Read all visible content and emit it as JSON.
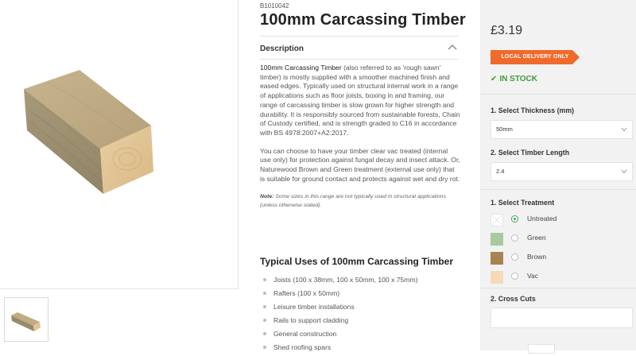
{
  "product": {
    "sku": "B1010042",
    "title": "100mm Carcassing Timber",
    "image_alt": "timber-plank-image"
  },
  "description": {
    "header": "Description",
    "para1_strong": "100mm Carcassing Timber",
    "para1_rest": " (also referred to as 'rough sawn' timber) is mostly supplied with a smoother machined finish and eased edges. Typically used on structural internal work in a range of applications such as floor joists, boxing in and framing, our range of carcassing timber is slow grown for higher strength and durability. It is responsibly sourced from sustainable forests, Chain of Custody certified, and is strength graded to C16 in accordance with BS 4978:2007+A2:2017.",
    "para2": "You can choose to have your timber clear vac treated (internal use only) for protection against fungal decay and insect attack. Or, Naturewood Brown and Green treatment (external use only) that is suitable for ground contact and protects against wet and dry rot.",
    "note_label": "Note:",
    "note_text": " Some sizes in this range are not typically used in structural applications (unless otherwise stated)."
  },
  "uses": {
    "title": "Typical Uses of 100mm Carcassing Timber",
    "items": [
      "Joists (100 x 38mm, 100 x 50mm, 100 x 75mm)",
      "Rafters (100 x 50mm)",
      "Leisure timber installations",
      "Rails to support cladding",
      "General construction",
      "Shed roofing spars"
    ]
  },
  "purchase": {
    "price": "£3.19",
    "delivery_badge": "LOCAL DELIVERY ONLY",
    "stock": "IN STOCK",
    "thickness_label": "1. Select Thickness (mm)",
    "thickness_value": "50mm",
    "length_label": "2. Select Timber Length",
    "length_value": "2.4",
    "treatment_label": "1. Select Treatment",
    "treatments": [
      {
        "label": "Untreated",
        "selected": true,
        "color": "#ffffff"
      },
      {
        "label": "Green",
        "selected": false,
        "color": "#a9c9a0"
      },
      {
        "label": "Brown",
        "selected": false,
        "color": "#a88353"
      },
      {
        "label": "Vac",
        "selected": false,
        "color": "#f6d9b6"
      }
    ],
    "crosscuts_label": "2. Cross Cuts",
    "crosscuts_value": ""
  },
  "colors": {
    "accent_orange": "#ef6a2b",
    "stock_green": "#3f9a3b",
    "panel_bg": "#f2f2f2"
  }
}
